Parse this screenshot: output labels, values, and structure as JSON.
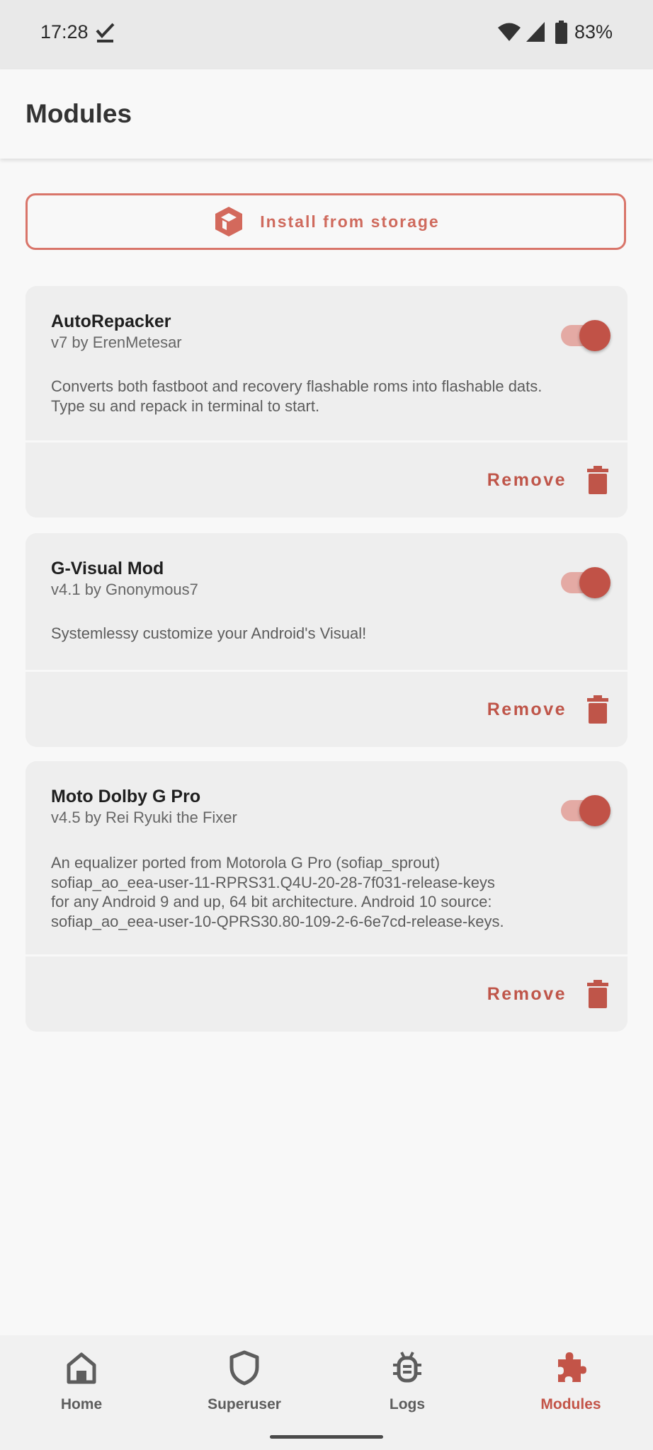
{
  "status_bar": {
    "time": "17:28",
    "battery": "83%",
    "icons": [
      "check-download-icon",
      "wifi-icon",
      "signal-icon",
      "battery-icon"
    ]
  },
  "app_bar": {
    "title": "Modules"
  },
  "install_button": {
    "label": "Install from storage",
    "icon": "package-icon"
  },
  "modules": [
    {
      "name": "AutoRepacker",
      "version": "v7 by ErenMetesar",
      "description": "Converts both fastboot and recovery flashable roms into flashable dats.\nType su and repack in terminal to start.",
      "enabled": true,
      "remove_label": "Remove"
    },
    {
      "name": "G-Visual Mod",
      "version": "v4.1 by Gnonymous7",
      "description": "Systemlessy customize your Android's Visual!",
      "enabled": true,
      "remove_label": "Remove"
    },
    {
      "name": "Moto Dolby G Pro",
      "version": "v4.5 by Rei Ryuki the Fixer",
      "description": "An equalizer ported from Motorola G Pro (sofiap_sprout)\nsofiap_ao_eea-user-11-RPRS31.Q4U-20-28-7f031-release-keys\nfor any Android 9 and up, 64 bit architecture. Android 10 source:\nsofiap_ao_eea-user-10-QPRS30.80-109-2-6-6e7cd-release-keys.",
      "enabled": true,
      "remove_label": "Remove"
    }
  ],
  "bottom_nav": [
    {
      "label": "Home",
      "icon": "home-icon",
      "active": false
    },
    {
      "label": "Superuser",
      "icon": "shield-icon",
      "active": false
    },
    {
      "label": "Logs",
      "icon": "bug-icon",
      "active": false
    },
    {
      "label": "Modules",
      "icon": "puzzle-icon",
      "active": true
    }
  ],
  "colors": {
    "accent": "#c35448",
    "accent_light": "#e4aaa4",
    "outline": "#d9756a",
    "card_bg": "#eeeeee",
    "page_bg": "#f8f8f8"
  }
}
